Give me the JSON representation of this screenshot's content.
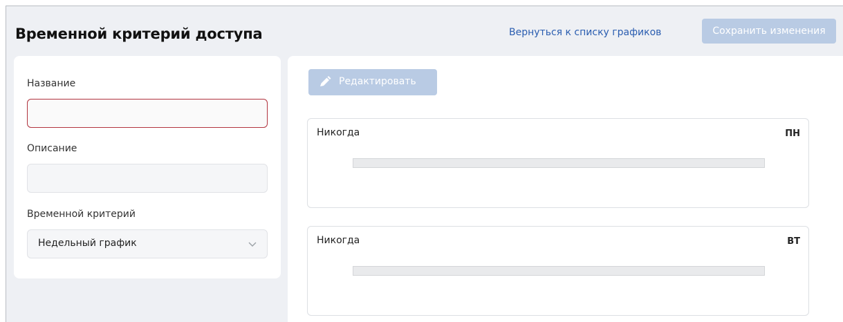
{
  "header": {
    "title": "Временной критерий доступа",
    "back_link": "Вернуться к списку графиков",
    "save_label": "Сохранить изменения"
  },
  "form": {
    "name_label": "Название",
    "name_value": "",
    "description_label": "Описание",
    "description_value": "",
    "criteria_label": "Временной критерий",
    "criteria_value": "Недельный график"
  },
  "schedule": {
    "edit_label": "Редактировать",
    "days": [
      {
        "state": "Никогда",
        "day": "ПН"
      },
      {
        "state": "Никогда",
        "day": "ВТ"
      }
    ]
  },
  "colors": {
    "accent_disabled": "#b9cbe4",
    "link": "#2a5db0",
    "error_border": "#b1323d"
  },
  "icons": [
    "pencil-icon",
    "chevron-down-icon"
  ]
}
